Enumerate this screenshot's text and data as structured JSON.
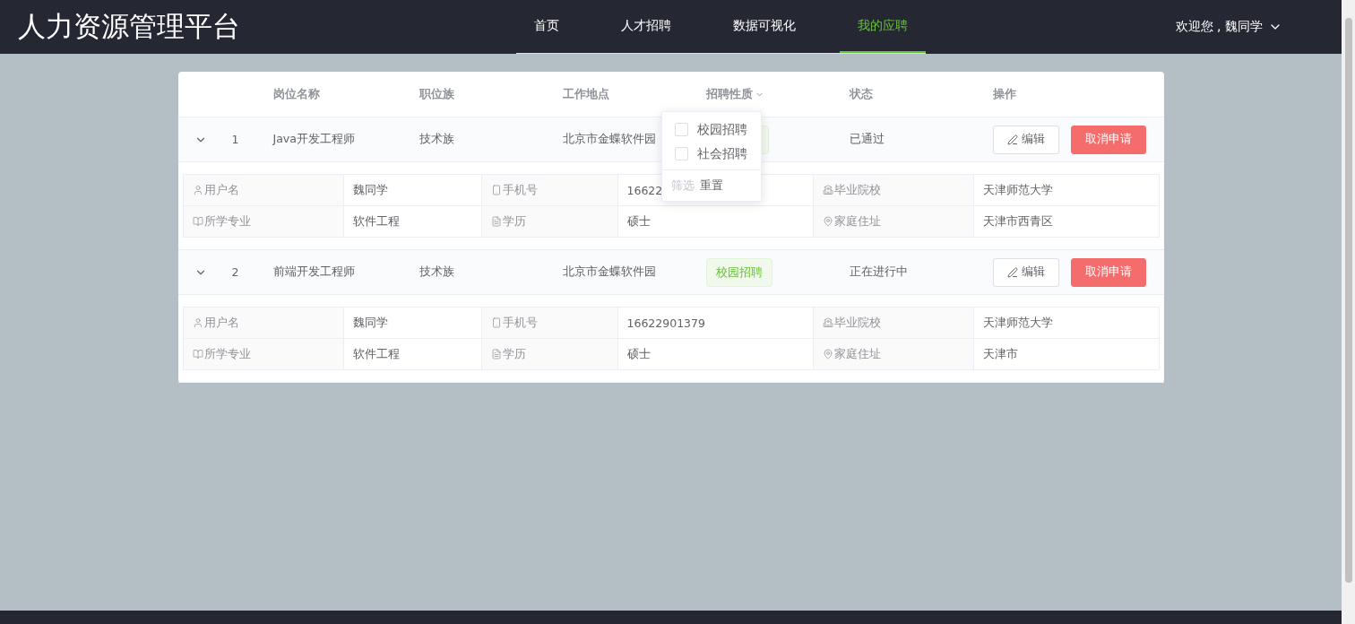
{
  "header": {
    "logo": "人力资源管理平台",
    "nav": [
      {
        "label": "首页",
        "selected": false
      },
      {
        "label": "人才招聘",
        "selected": false
      },
      {
        "label": "数据可视化",
        "selected": false
      },
      {
        "label": "我的应聘",
        "selected": true
      }
    ],
    "user": {
      "greeting": "欢迎您 , 魏同学"
    }
  },
  "table": {
    "columns": [
      {
        "label": "岗位名称",
        "filter": false
      },
      {
        "label": "职位族",
        "filter": false
      },
      {
        "label": "工作地点",
        "filter": false
      },
      {
        "label": "招聘性质",
        "filter": true
      },
      {
        "label": "状态",
        "filter": false
      },
      {
        "label": "操作",
        "filter": false
      }
    ],
    "rows": [
      {
        "expanded": true,
        "index": "1",
        "name": "Java开发工程师",
        "family": "技术族",
        "location": "北京市金蝶软件园",
        "status": "已通过",
        "actions": [
          {
            "label": "编辑",
            "kind": "edit"
          },
          {
            "label": "取消申请",
            "kind": "danger"
          }
        ],
        "details": [
          {
            "kind": "user",
            "label": "用户名",
            "value": "魏同学"
          },
          {
            "kind": "phone",
            "label": "手机号",
            "value": "16622"
          },
          {
            "kind": "school",
            "label": "毕业院校",
            "value": "天津师范大学"
          },
          {
            "kind": "book",
            "label": "所学专业",
            "value": "软件工程"
          },
          {
            "kind": "document",
            "label": "学历",
            "value": "硕士"
          },
          {
            "kind": "location",
            "label": "家庭住址",
            "value": "天津市西青区"
          }
        ]
      },
      {
        "expanded": true,
        "index": "2",
        "name": "前端开发工程师",
        "family": "技术族",
        "location": "北京市金蝶软件园",
        "recruit_type": "校园招聘",
        "status": "正在进行中",
        "actions": [
          {
            "label": "编辑",
            "kind": "edit"
          },
          {
            "label": "取消申请",
            "kind": "danger"
          }
        ],
        "details": [
          {
            "kind": "user",
            "label": "用户名",
            "value": "魏同学"
          },
          {
            "kind": "phone",
            "label": "手机号",
            "value": "16622901379"
          },
          {
            "kind": "school",
            "label": "毕业院校",
            "value": "天津师范大学"
          },
          {
            "kind": "book",
            "label": "所学专业",
            "value": "软件工程"
          },
          {
            "kind": "document",
            "label": "学历",
            "value": "硕士"
          },
          {
            "kind": "location",
            "label": "家庭住址",
            "value": "天津市"
          }
        ]
      }
    ]
  },
  "filter_menu": {
    "options": [
      {
        "label": "校园招聘",
        "checked": false
      },
      {
        "label": "社会招聘",
        "checked": false
      }
    ],
    "actions": [
      {
        "label": "筛选",
        "disabled": true
      },
      {
        "label": "重置",
        "disabled": false
      }
    ]
  }
}
